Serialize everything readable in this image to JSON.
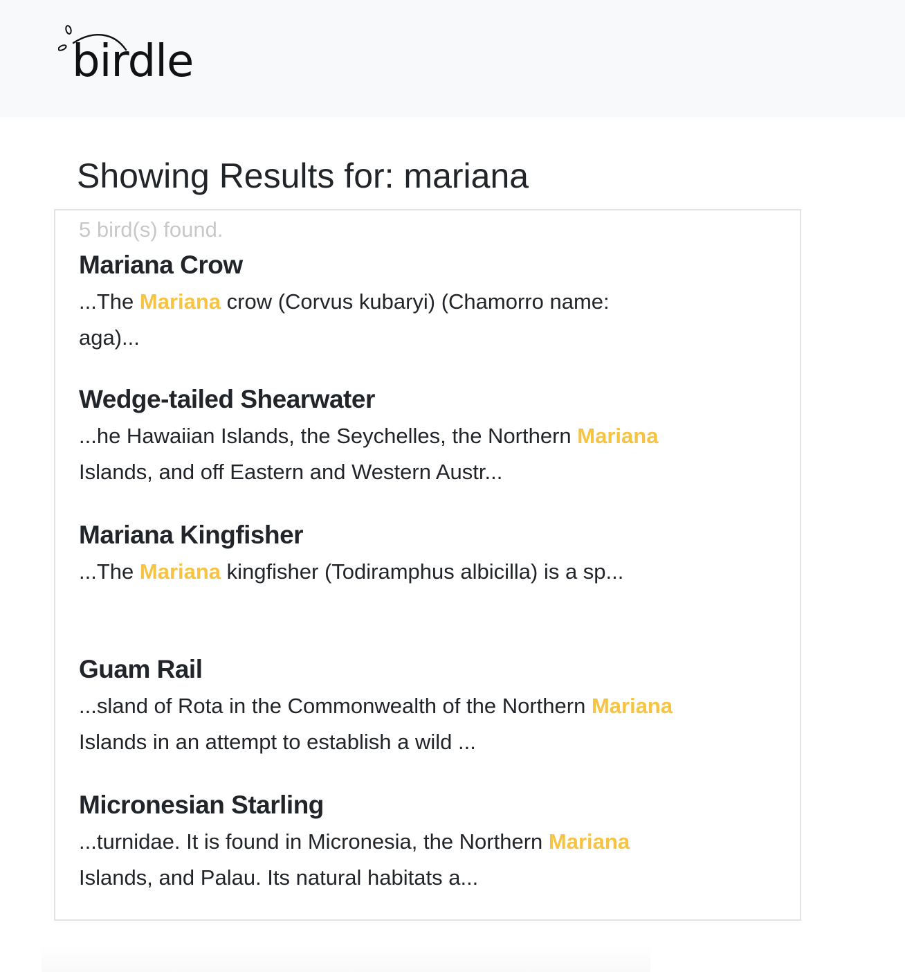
{
  "header": {
    "brand": "birdle"
  },
  "main": {
    "title": "Showing Results for: mariana",
    "count_text": "5 bird(s) found.",
    "results": [
      {
        "name": "Mariana Crow",
        "before": "...The ",
        "match": "Mariana",
        "after": " crow (Corvus kubaryi) (Chamorro name: aga)..."
      },
      {
        "name": "Wedge-tailed Shearwater",
        "before": "...he Hawaiian Islands, the Seychelles, the Northern ",
        "match": "Mariana",
        "after": " Islands, and off Eastern and Western Austr..."
      },
      {
        "name": "Mariana Kingfisher",
        "before": "...The ",
        "match": "Mariana",
        "after": " kingfisher (Todiramphus albicilla) is a sp..."
      },
      {
        "name": "Guam Rail",
        "before": "...sland of Rota in the Commonwealth of the Northern ",
        "match": "Mariana",
        "after": " Islands in an attempt to establish a wild ..."
      },
      {
        "name": "Micronesian Starling",
        "before": "...turnidae. It is found in Micronesia, the Northern ",
        "match": "Mariana",
        "after": " Islands, and Palau. Its natural habitats a..."
      }
    ]
  },
  "colors": {
    "highlight": "#f6c343",
    "navbar_bg": "#f8f9fa",
    "muted_text": "#c8c8c8"
  },
  "icons": {
    "logo": "bird-tail-logo-icon"
  }
}
